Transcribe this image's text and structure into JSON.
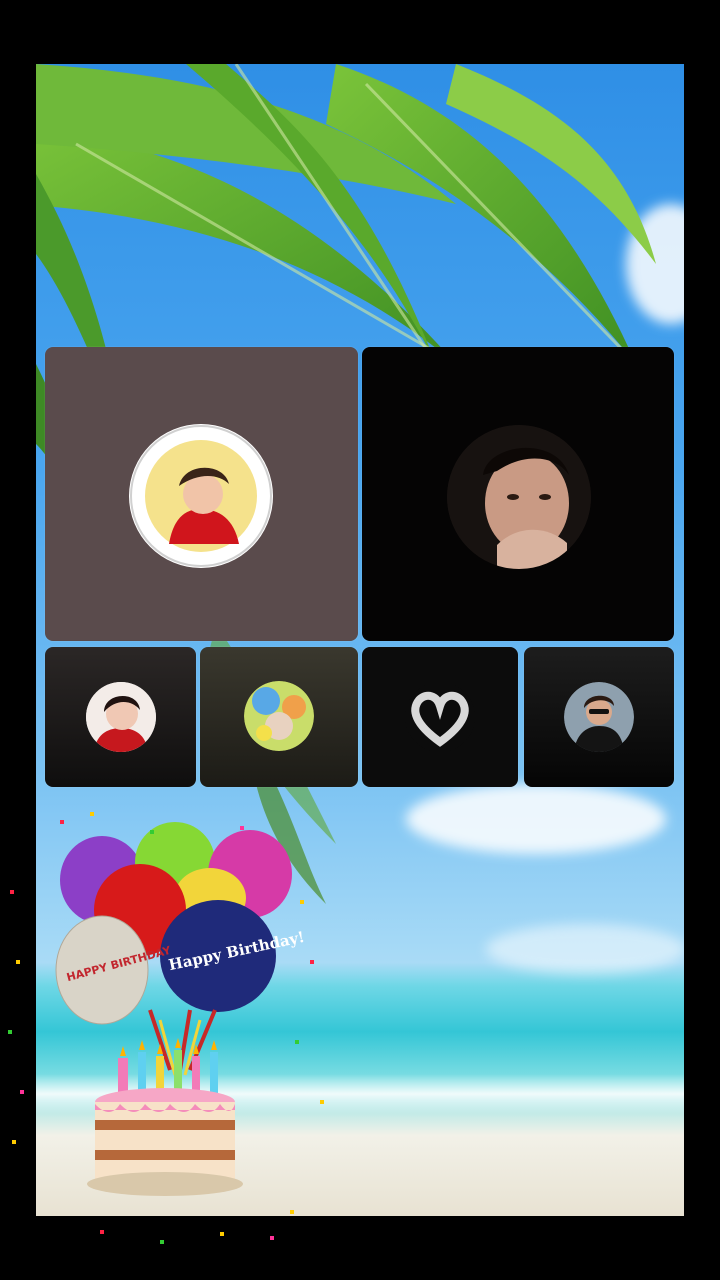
{
  "participants": [
    {
      "id": "host",
      "avatar_icon": "user-avatar-red-shirt",
      "tile_color": "#5a4b4c"
    },
    {
      "id": "guest-1",
      "avatar_icon": "user-avatar-dark-hair",
      "tile_color": "#050404"
    },
    {
      "id": "guest-2",
      "avatar_icon": "user-avatar-woman",
      "tile_color": "#1c1a1a"
    },
    {
      "id": "guest-3",
      "avatar_icon": "user-avatar-colorful",
      "tile_color": "#2a2a22"
    },
    {
      "id": "guest-4",
      "avatar_icon": "heart-hands-icon",
      "tile_color": "#0c0c0c"
    },
    {
      "id": "guest-5",
      "avatar_icon": "user-avatar-sunglasses",
      "tile_color": "#0d0d0d"
    }
  ],
  "decorations": {
    "balloon_text_1": "HAPPY BIRTHDAY",
    "balloon_text_2": "Happy Birthday!"
  },
  "colors": {
    "frame": "#000000",
    "sky": "#4aa6ef",
    "sea": "#34c6d6"
  }
}
